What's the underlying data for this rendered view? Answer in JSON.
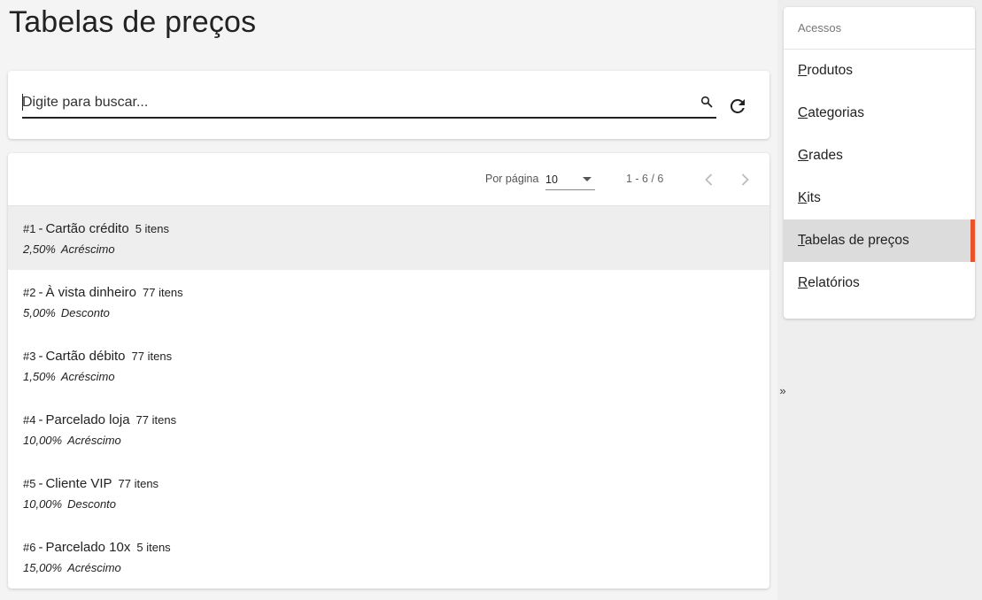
{
  "page": {
    "title": "Tabelas de preços"
  },
  "search": {
    "placeholder": "Digite para buscar..."
  },
  "pager": {
    "per_page_label": "Por página",
    "per_page_value": "10",
    "range": "1 - 6 / 6"
  },
  "rows": [
    {
      "id": "#1",
      "name": "Cartão crédito",
      "count": "5 itens",
      "pct": "2,50%",
      "type": "Acréscimo",
      "selected": true
    },
    {
      "id": "#2",
      "name": "À vista dinheiro",
      "count": "77 itens",
      "pct": "5,00%",
      "type": "Desconto"
    },
    {
      "id": "#3",
      "name": "Cartão débito",
      "count": "77 itens",
      "pct": "1,50%",
      "type": "Acréscimo"
    },
    {
      "id": "#4",
      "name": "Parcelado loja",
      "count": "77 itens",
      "pct": "10,00%",
      "type": "Acréscimo"
    },
    {
      "id": "#5",
      "name": "Cliente VIP",
      "count": "77 itens",
      "pct": "10,00%",
      "type": "Desconto"
    },
    {
      "id": "#6",
      "name": "Parcelado 10x",
      "count": "5 itens",
      "pct": "15,00%",
      "type": "Acréscimo"
    }
  ],
  "sidebar": {
    "header": "Acessos",
    "collapse_glyph": "»",
    "items": [
      {
        "first": "P",
        "rest": "rodutos"
      },
      {
        "first": "C",
        "rest": "ategorias"
      },
      {
        "first": "G",
        "rest": "rades"
      },
      {
        "first": "K",
        "rest": "its"
      },
      {
        "first": "T",
        "rest": "abelas de preços",
        "active": true
      },
      {
        "first": "R",
        "rest": "elatórios"
      }
    ]
  },
  "colors": {
    "accent": "#e8532b",
    "selected_row": "#eeeeee",
    "active_nav": "#dcdcdc"
  },
  "icons": {
    "search": "search-icon",
    "refresh": "refresh-icon",
    "prev": "chevron-left-icon",
    "next": "chevron-right-icon",
    "dropdown": "dropdown-arrow-icon",
    "collapse": "double-chevron-right-icon"
  }
}
